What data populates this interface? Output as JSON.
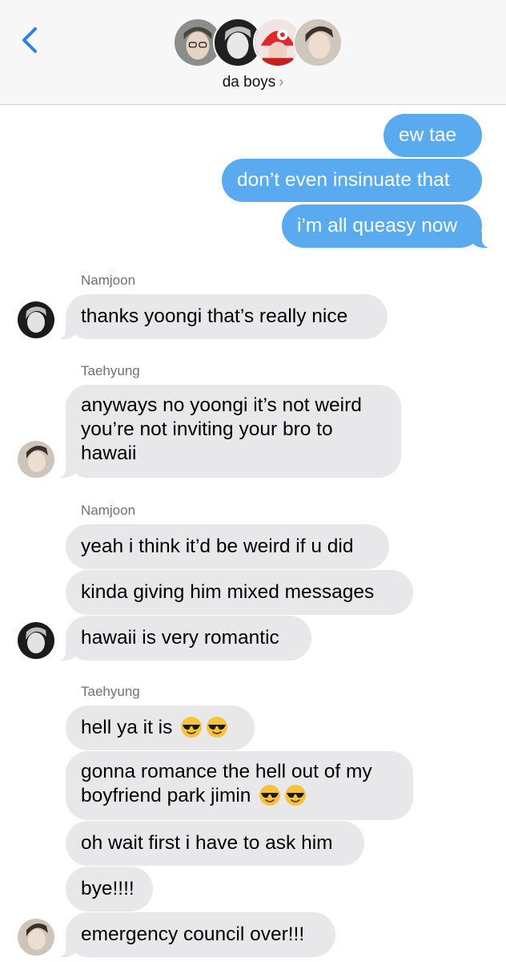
{
  "header": {
    "group_name": "da boys",
    "chevron": "›",
    "back_icon": "chevron-left-icon",
    "avatar_count": 4
  },
  "colors": {
    "outgoing_bubble": "#5aaaf0",
    "incoming_bubble": "#e8e8eb",
    "accent": "#2f80ed"
  },
  "messages": {
    "out1": "ew tae",
    "out2": "don’t even insinuate that",
    "out3": "i’m all queasy now",
    "sender1": "Namjoon",
    "m1": "thanks yoongi that’s really nice",
    "sender2": "Taehyung",
    "m2_line1": "anyways no yoongi it’s not weird",
    "m2_line2": "you’re not inviting your bro to",
    "m2_line3": "hawaii",
    "sender3": "Namjoon",
    "m3": "yeah i think it’d be weird if u did",
    "m4": "kinda giving him mixed messages",
    "m5": "hawaii is very romantic",
    "sender4": "Taehyung",
    "m6": "hell ya it is",
    "m7_line1": "gonna romance the hell out of my",
    "m7_line2": "boyfriend park jimin",
    "m8": "oh wait first i have to ask him",
    "m9": "bye!!!!",
    "m10": "emergency council over!!!"
  },
  "emoji": "sunglasses-face"
}
